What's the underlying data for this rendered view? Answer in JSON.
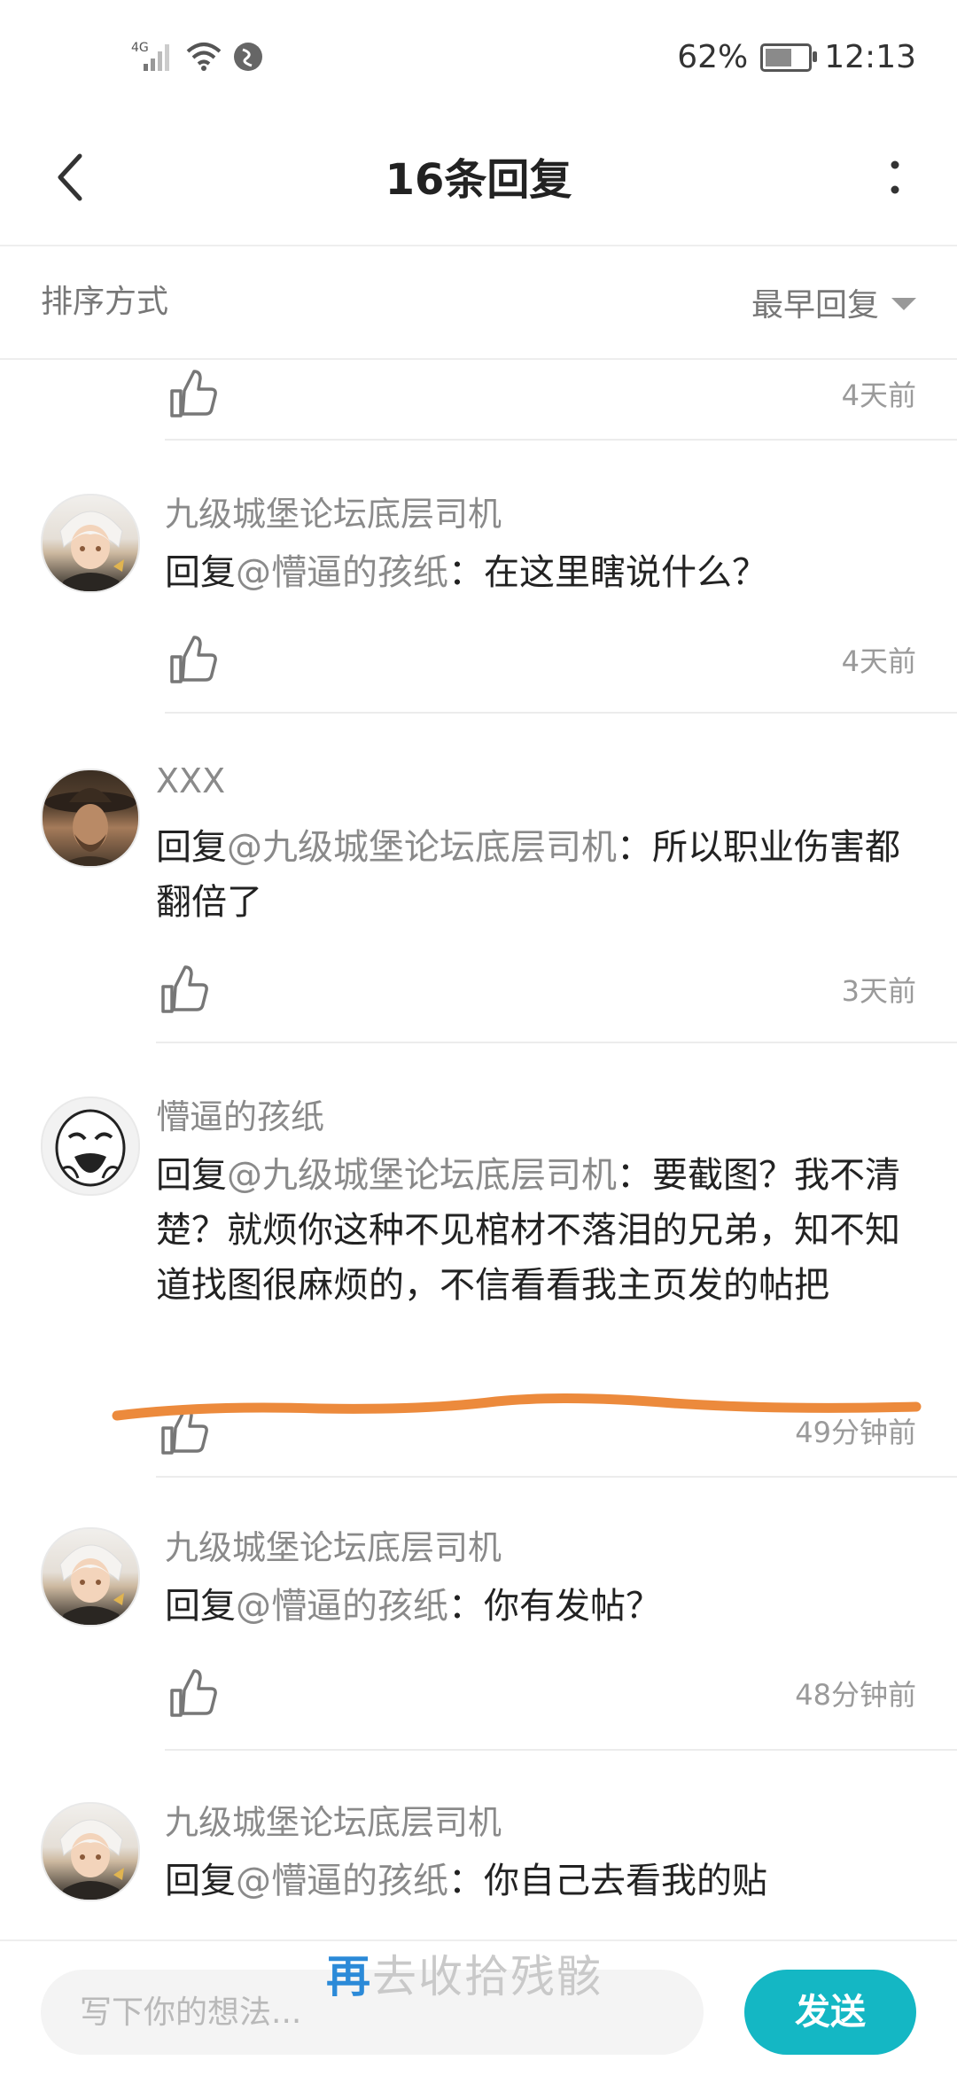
{
  "status_bar": {
    "network": "4G",
    "battery": "62%",
    "time": "12:13"
  },
  "header": {
    "title": "16条回复"
  },
  "sort": {
    "label": "排序方式",
    "value": "最早回复"
  },
  "top_partial": {
    "time": "4天前"
  },
  "comments": [
    {
      "author": "九级城堡论坛底层司机",
      "reply_prefix": "回复",
      "mention": "@懵逼的孩纸",
      "separator": "：",
      "text": "在这里瞎说什么？",
      "time": "4天前",
      "avatar": "anime-white-hair-avatar"
    },
    {
      "author": "XXX",
      "reply_prefix": "回复",
      "mention": "@九级城堡论坛底层司机",
      "separator": "：",
      "text": "所以职业伤害都翻倍了",
      "time": "3天前",
      "avatar": "cowboy-avatar"
    },
    {
      "author": "懵逼的孩纸",
      "reply_prefix": "回复",
      "mention": "@九级城堡论坛底层司机",
      "separator": "：",
      "text": "要截图？我不清楚？就烦你这种不见棺材不落泪的兄弟，知不知道找图很麻烦的，不信看看我主页发的帖把",
      "time": "49分钟前",
      "avatar": "meme-face-avatar"
    },
    {
      "author": "九级城堡论坛底层司机",
      "reply_prefix": "回复",
      "mention": "@懵逼的孩纸",
      "separator": "：",
      "text": "你有发帖？",
      "time": "48分钟前",
      "avatar": "anime-white-hair-avatar"
    },
    {
      "author": "九级城堡论坛底层司机",
      "reply_prefix": "回复",
      "mention": "@懵逼的孩纸",
      "separator": "：",
      "text": "你自己去看我的贴",
      "time": "",
      "avatar": "anime-white-hair-avatar"
    }
  ],
  "input": {
    "placeholder": "写下你的想法...",
    "send_label": "发送"
  },
  "watermark": {
    "first": "再",
    "rest": "去收拾残骸"
  },
  "colors": {
    "accent": "#14b7c4",
    "annotation": "#ec8a3c",
    "mention": "#8a8a8a"
  }
}
